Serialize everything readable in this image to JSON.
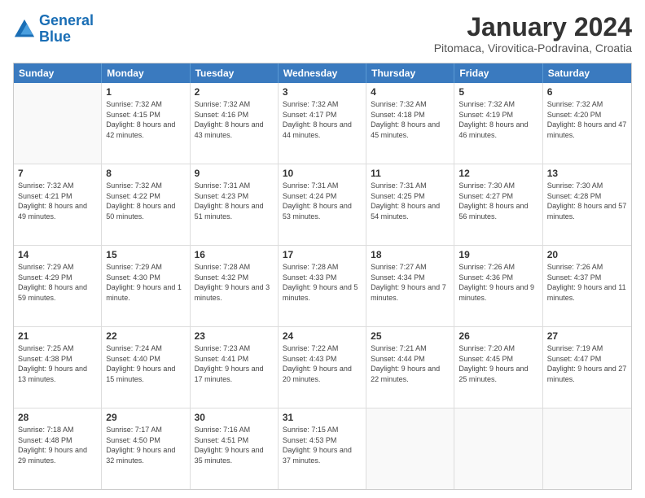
{
  "logo": {
    "line1": "General",
    "line2": "Blue"
  },
  "title": "January 2024",
  "subtitle": "Pitomaca, Virovitica-Podravina, Croatia",
  "header_days": [
    "Sunday",
    "Monday",
    "Tuesday",
    "Wednesday",
    "Thursday",
    "Friday",
    "Saturday"
  ],
  "weeks": [
    [
      {
        "day": "",
        "sunrise": "",
        "sunset": "",
        "daylight": ""
      },
      {
        "day": "1",
        "sunrise": "Sunrise: 7:32 AM",
        "sunset": "Sunset: 4:15 PM",
        "daylight": "Daylight: 8 hours and 42 minutes."
      },
      {
        "day": "2",
        "sunrise": "Sunrise: 7:32 AM",
        "sunset": "Sunset: 4:16 PM",
        "daylight": "Daylight: 8 hours and 43 minutes."
      },
      {
        "day": "3",
        "sunrise": "Sunrise: 7:32 AM",
        "sunset": "Sunset: 4:17 PM",
        "daylight": "Daylight: 8 hours and 44 minutes."
      },
      {
        "day": "4",
        "sunrise": "Sunrise: 7:32 AM",
        "sunset": "Sunset: 4:18 PM",
        "daylight": "Daylight: 8 hours and 45 minutes."
      },
      {
        "day": "5",
        "sunrise": "Sunrise: 7:32 AM",
        "sunset": "Sunset: 4:19 PM",
        "daylight": "Daylight: 8 hours and 46 minutes."
      },
      {
        "day": "6",
        "sunrise": "Sunrise: 7:32 AM",
        "sunset": "Sunset: 4:20 PM",
        "daylight": "Daylight: 8 hours and 47 minutes."
      }
    ],
    [
      {
        "day": "7",
        "sunrise": "Sunrise: 7:32 AM",
        "sunset": "Sunset: 4:21 PM",
        "daylight": "Daylight: 8 hours and 49 minutes."
      },
      {
        "day": "8",
        "sunrise": "Sunrise: 7:32 AM",
        "sunset": "Sunset: 4:22 PM",
        "daylight": "Daylight: 8 hours and 50 minutes."
      },
      {
        "day": "9",
        "sunrise": "Sunrise: 7:31 AM",
        "sunset": "Sunset: 4:23 PM",
        "daylight": "Daylight: 8 hours and 51 minutes."
      },
      {
        "day": "10",
        "sunrise": "Sunrise: 7:31 AM",
        "sunset": "Sunset: 4:24 PM",
        "daylight": "Daylight: 8 hours and 53 minutes."
      },
      {
        "day": "11",
        "sunrise": "Sunrise: 7:31 AM",
        "sunset": "Sunset: 4:25 PM",
        "daylight": "Daylight: 8 hours and 54 minutes."
      },
      {
        "day": "12",
        "sunrise": "Sunrise: 7:30 AM",
        "sunset": "Sunset: 4:27 PM",
        "daylight": "Daylight: 8 hours and 56 minutes."
      },
      {
        "day": "13",
        "sunrise": "Sunrise: 7:30 AM",
        "sunset": "Sunset: 4:28 PM",
        "daylight": "Daylight: 8 hours and 57 minutes."
      }
    ],
    [
      {
        "day": "14",
        "sunrise": "Sunrise: 7:29 AM",
        "sunset": "Sunset: 4:29 PM",
        "daylight": "Daylight: 8 hours and 59 minutes."
      },
      {
        "day": "15",
        "sunrise": "Sunrise: 7:29 AM",
        "sunset": "Sunset: 4:30 PM",
        "daylight": "Daylight: 9 hours and 1 minute."
      },
      {
        "day": "16",
        "sunrise": "Sunrise: 7:28 AM",
        "sunset": "Sunset: 4:32 PM",
        "daylight": "Daylight: 9 hours and 3 minutes."
      },
      {
        "day": "17",
        "sunrise": "Sunrise: 7:28 AM",
        "sunset": "Sunset: 4:33 PM",
        "daylight": "Daylight: 9 hours and 5 minutes."
      },
      {
        "day": "18",
        "sunrise": "Sunrise: 7:27 AM",
        "sunset": "Sunset: 4:34 PM",
        "daylight": "Daylight: 9 hours and 7 minutes."
      },
      {
        "day": "19",
        "sunrise": "Sunrise: 7:26 AM",
        "sunset": "Sunset: 4:36 PM",
        "daylight": "Daylight: 9 hours and 9 minutes."
      },
      {
        "day": "20",
        "sunrise": "Sunrise: 7:26 AM",
        "sunset": "Sunset: 4:37 PM",
        "daylight": "Daylight: 9 hours and 11 minutes."
      }
    ],
    [
      {
        "day": "21",
        "sunrise": "Sunrise: 7:25 AM",
        "sunset": "Sunset: 4:38 PM",
        "daylight": "Daylight: 9 hours and 13 minutes."
      },
      {
        "day": "22",
        "sunrise": "Sunrise: 7:24 AM",
        "sunset": "Sunset: 4:40 PM",
        "daylight": "Daylight: 9 hours and 15 minutes."
      },
      {
        "day": "23",
        "sunrise": "Sunrise: 7:23 AM",
        "sunset": "Sunset: 4:41 PM",
        "daylight": "Daylight: 9 hours and 17 minutes."
      },
      {
        "day": "24",
        "sunrise": "Sunrise: 7:22 AM",
        "sunset": "Sunset: 4:43 PM",
        "daylight": "Daylight: 9 hours and 20 minutes."
      },
      {
        "day": "25",
        "sunrise": "Sunrise: 7:21 AM",
        "sunset": "Sunset: 4:44 PM",
        "daylight": "Daylight: 9 hours and 22 minutes."
      },
      {
        "day": "26",
        "sunrise": "Sunrise: 7:20 AM",
        "sunset": "Sunset: 4:45 PM",
        "daylight": "Daylight: 9 hours and 25 minutes."
      },
      {
        "day": "27",
        "sunrise": "Sunrise: 7:19 AM",
        "sunset": "Sunset: 4:47 PM",
        "daylight": "Daylight: 9 hours and 27 minutes."
      }
    ],
    [
      {
        "day": "28",
        "sunrise": "Sunrise: 7:18 AM",
        "sunset": "Sunset: 4:48 PM",
        "daylight": "Daylight: 9 hours and 29 minutes."
      },
      {
        "day": "29",
        "sunrise": "Sunrise: 7:17 AM",
        "sunset": "Sunset: 4:50 PM",
        "daylight": "Daylight: 9 hours and 32 minutes."
      },
      {
        "day": "30",
        "sunrise": "Sunrise: 7:16 AM",
        "sunset": "Sunset: 4:51 PM",
        "daylight": "Daylight: 9 hours and 35 minutes."
      },
      {
        "day": "31",
        "sunrise": "Sunrise: 7:15 AM",
        "sunset": "Sunset: 4:53 PM",
        "daylight": "Daylight: 9 hours and 37 minutes."
      },
      {
        "day": "",
        "sunrise": "",
        "sunset": "",
        "daylight": ""
      },
      {
        "day": "",
        "sunrise": "",
        "sunset": "",
        "daylight": ""
      },
      {
        "day": "",
        "sunrise": "",
        "sunset": "",
        "daylight": ""
      }
    ]
  ]
}
